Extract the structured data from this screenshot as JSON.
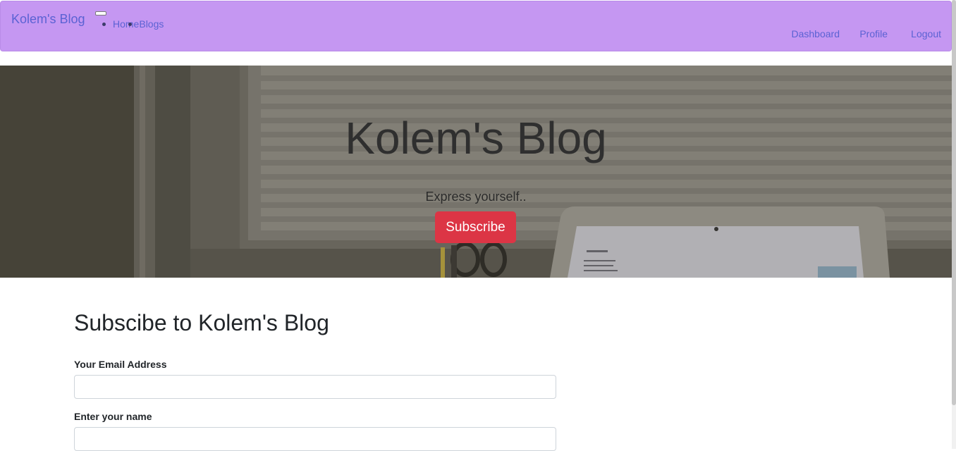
{
  "navbar": {
    "brand": "Kolem's Blog",
    "links": [
      "Home",
      "Blogs"
    ],
    "right_links": [
      "Dashboard",
      "Profile",
      "Logout"
    ],
    "colors": {
      "background": "#c597f2",
      "link": "#5b62d3"
    }
  },
  "hero": {
    "title": "Kolem's Blog",
    "subtitle": "Express yourself..",
    "button_label": "Subscribe",
    "colors": {
      "button": "#dc3545"
    }
  },
  "form": {
    "title": "Subscibe to Kolem's Blog",
    "email_label": "Your Email Address",
    "email_value": "",
    "name_label": "Enter your name",
    "name_value": ""
  }
}
